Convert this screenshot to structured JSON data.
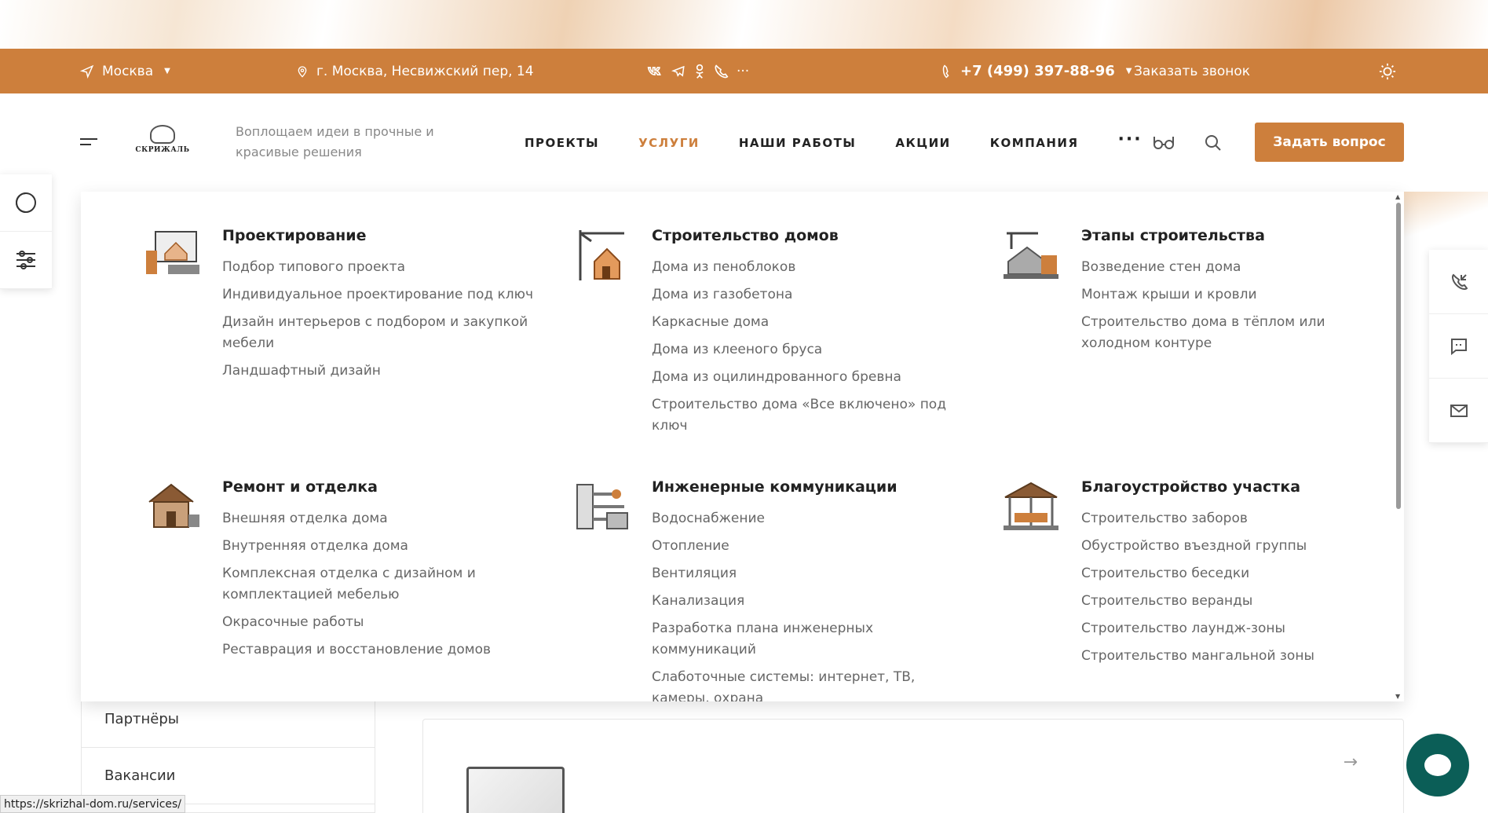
{
  "topbar": {
    "city": "Москва",
    "address": "г. Москва, Несвижский пер, 14",
    "socials": [
      "vk-icon",
      "telegram-icon",
      "odnoklassniki-icon",
      "viber-icon"
    ],
    "more": "···",
    "phone": "+7 (499) 397-88-96",
    "callback": "Заказать звонок"
  },
  "header": {
    "logo_text": "СКРИЖАЛЬ",
    "slogan": "Воплощаем идеи в прочные и красивые решения",
    "nav": [
      "ПРОЕКТЫ",
      "УСЛУГИ",
      "НАШИ РАБОТЫ",
      "АКЦИИ",
      "КОМПАНИЯ"
    ],
    "nav_more": "···",
    "ask_button": "Задать вопрос"
  },
  "menu": [
    {
      "title": "Проектирование",
      "icon": "design-computer-icon",
      "items": [
        "Подбор типового проекта",
        "Индивидуальное проектирование под ключ",
        "Дизайн интерьеров с подбором и закупкой мебели",
        "Ландшафтный дизайн"
      ]
    },
    {
      "title": "Строительство домов",
      "icon": "crane-house-icon",
      "items": [
        "Дома из пеноблоков",
        "Дома из газобетона",
        "Каркасные дома",
        "Дома из клееного бруса",
        "Дома из оцилиндрованного бревна",
        "Строительство дома «Все включено» под ключ"
      ]
    },
    {
      "title": "Этапы строительства",
      "icon": "construction-stage-icon",
      "items": [
        "Возведение стен дома",
        "Монтаж крыши и кровли",
        "Строительство дома в тёплом или холодном контуре"
      ]
    },
    {
      "title": "Ремонт и отделка",
      "icon": "repair-house-icon",
      "items": [
        "Внешняя отделка дома",
        "Внутренняя отделка дома",
        "Комплексная отделка с дизайном и комплектацией мебелью",
        "Окрасочные работы",
        "Реставрация и восстановление домов"
      ]
    },
    {
      "title": "Инженерные коммуникации",
      "icon": "engineering-icon",
      "items": [
        "Водоснабжение",
        "Отопление",
        "Вентиляция",
        "Канализация",
        "Разработка плана инженерных коммуникаций",
        "Слаботочные системы: интернет, ТВ, камеры, охрана"
      ]
    },
    {
      "title": "Благоустройство участка",
      "icon": "gazebo-icon",
      "items": [
        "Строительство заборов",
        "Обустройство въездной группы",
        "Строительство беседки",
        "Строительство веранды",
        "Строительство лаундж-зоны",
        "Строительство мангальной зоны"
      ]
    }
  ],
  "sidebar_list": [
    "Партнёры",
    "Вакансии"
  ],
  "status_url": "https://skrizhal-dom.ru/services/",
  "colors": {
    "accent": "#cd7f3c",
    "chat": "#0b5e57"
  }
}
